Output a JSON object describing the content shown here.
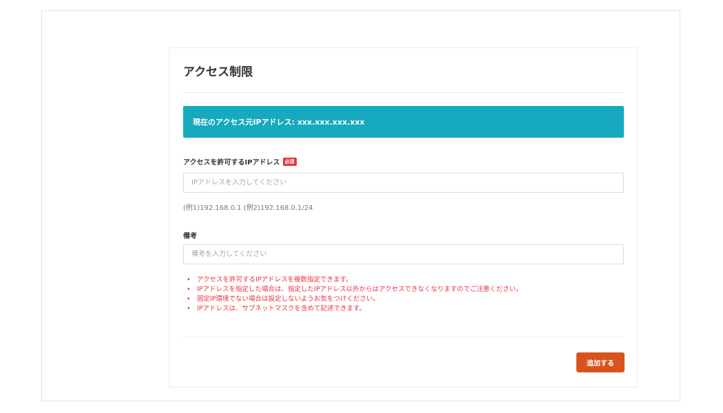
{
  "colors": {
    "banner_bg": "#17a9bd",
    "accent_red": "#e8343e",
    "button_bg": "#d9531e"
  },
  "card": {
    "title": "アクセス制限"
  },
  "banner": {
    "text": "現在のアクセス元IPアドレス: xxx.xxx.xxx.xxx"
  },
  "ip_field": {
    "label": "アクセスを許可するIPアドレス",
    "required_badge": "必須",
    "placeholder": "IPアドレスを入力してください",
    "value": "",
    "example": "(例1)192.168.0.1 (例2)192.168.0.1/24"
  },
  "memo_field": {
    "label": "備考",
    "placeholder": "備考を入力してください",
    "value": ""
  },
  "notes": [
    "アクセスを許可するIPアドレスを複数指定できます。",
    "IPアドレスを指定した場合は、指定したIPアドレス以外からはアクセスできなくなりますのでご注意ください。",
    "固定IP環境でない場合は設定しないようお気をつけください。",
    "IPアドレスは、サブネットマスクを含めて記述できます。"
  ],
  "bullet_glyph": "•",
  "submit_button": {
    "label": "追加する"
  }
}
